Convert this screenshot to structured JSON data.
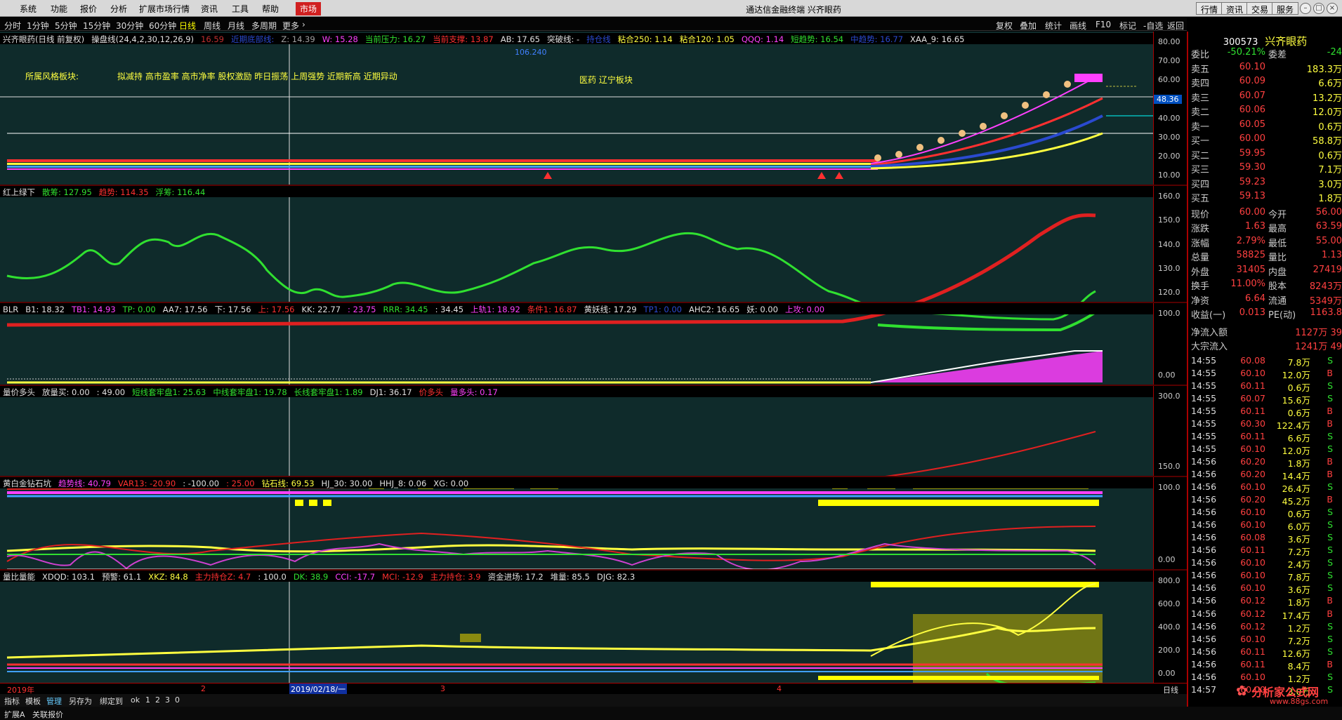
{
  "menu": {
    "items": [
      "系统",
      "功能",
      "报价",
      "分析",
      "扩展市场行情",
      "资讯",
      "工具",
      "帮助"
    ],
    "market": "市场"
  },
  "window": {
    "title": "通达信金融终端 兴齐眼药",
    "buttons": [
      "行情",
      "资讯",
      "交易",
      "服务"
    ]
  },
  "periods": {
    "items": [
      "分时",
      "1分钟",
      "5分钟",
      "15分钟",
      "30分钟",
      "60分钟",
      "日线",
      "周线",
      "月线",
      "多周期",
      "更多"
    ],
    "active": "日线"
  },
  "chart_tools": [
    "复权",
    "叠加",
    "统计",
    "画线",
    "F10",
    "标记",
    "-自选",
    "返回"
  ],
  "panes": [
    {
      "name": "main",
      "title_items": [
        {
          "t": "兴齐眼药(日线 前复权)",
          "c": "#e0e0e0"
        },
        {
          "t": "操盘线(24,4,2,30,12,26,9)",
          "c": "#e0e0e0"
        },
        {
          "t": "16.59",
          "c": "#c03030"
        },
        {
          "t": "近期底部线:",
          "c": "#2a4ad0"
        },
        {
          "t": "Z: 14.39",
          "c": "#a0a0a0"
        },
        {
          "t": "W: 15.28",
          "c": "#ff40ff"
        },
        {
          "t": "当前压力: 16.27",
          "c": "#30e030"
        },
        {
          "t": "当前支撑: 13.87",
          "c": "#ff3030"
        },
        {
          "t": "AB: 17.65",
          "c": "#e0e0e0"
        },
        {
          "t": "突破线: -",
          "c": "#e0e0e0"
        },
        {
          "t": "持仓线",
          "c": "#2a4ad0"
        },
        {
          "t": "粘合250: 1.14",
          "c": "#ffff40"
        },
        {
          "t": "粘合120: 1.05",
          "c": "#ffff40"
        },
        {
          "t": "QQQ: 1.14",
          "c": "#ff40ff"
        },
        {
          "t": "短趋势: 16.54",
          "c": "#30e030"
        },
        {
          "t": "中趋势: 16.77",
          "c": "#2a4ad0"
        },
        {
          "t": "XAA_9: 16.65",
          "c": "#e0e0e0"
        }
      ],
      "ticks": [
        "80.00",
        "70.00",
        "60.00",
        "50.00",
        "40.00",
        "30.00",
        "20.00",
        "10.00"
      ],
      "price_tag": "48.36",
      "peak_value": "106.240",
      "sector_label": "所属风格板块:",
      "style_tags": "拟减持 高市盈率 高市净率 股权激励 昨日振荡 上周强势 近期新高 近期异动",
      "industry": "医药 辽宁板块"
    },
    {
      "name": "hsl",
      "title_items": [
        {
          "t": "红上绿下",
          "c": "#e0e0e0"
        },
        {
          "t": "散筹: 127.95",
          "c": "#30e030"
        },
        {
          "t": "趋势: 114.35",
          "c": "#ff3030"
        },
        {
          "t": "浮筹: 116.44",
          "c": "#30e030"
        }
      ],
      "ticks": [
        "160.0",
        "150.0",
        "140.0",
        "130.0",
        "120.0"
      ]
    },
    {
      "name": "blr",
      "title_items": [
        {
          "t": "BLR",
          "c": "#e0e0e0"
        },
        {
          "t": "B1: 18.32",
          "c": "#e0e0e0"
        },
        {
          "t": "TB1: 14.93",
          "c": "#ff40ff"
        },
        {
          "t": "TP: 0.00",
          "c": "#30e030"
        },
        {
          "t": "AA7: 17.56",
          "c": "#e0e0e0"
        },
        {
          "t": "下: 17.56",
          "c": "#e0e0e0"
        },
        {
          "t": "上: 17.56",
          "c": "#ff3030"
        },
        {
          "t": "KK: 22.77",
          "c": "#e0e0e0"
        },
        {
          "t": ": 23.75",
          "c": "#ff40ff"
        },
        {
          "t": "RRR: 34.45",
          "c": "#30e030"
        },
        {
          "t": ": 34.45",
          "c": "#e0e0e0"
        },
        {
          "t": "上轨1: 18.92",
          "c": "#ff40ff"
        },
        {
          "t": "条件1: 16.87",
          "c": "#ff3030"
        },
        {
          "t": "黄妖线: 17.29",
          "c": "#e0e0e0"
        },
        {
          "t": "TP1: 0.00",
          "c": "#2a4ad0"
        },
        {
          "t": "AHC2: 16.65",
          "c": "#e0e0e0"
        },
        {
          "t": "妖: 0.00",
          "c": "#e0e0e0"
        },
        {
          "t": "上攻: 0.00",
          "c": "#ff40ff"
        }
      ],
      "ticks": [
        "100.0",
        "0.00"
      ]
    },
    {
      "name": "ljdt",
      "title_items": [
        {
          "t": "量价多头",
          "c": "#e0e0e0"
        },
        {
          "t": "放量买: 0.00",
          "c": "#e0e0e0"
        },
        {
          "t": ": 49.00",
          "c": "#e0e0e0"
        },
        {
          "t": "短线套牢盘1: 25.63",
          "c": "#30e030"
        },
        {
          "t": "中线套牢盘1: 19.78",
          "c": "#30e030"
        },
        {
          "t": "长线套牢盘1: 1.89",
          "c": "#30e030"
        },
        {
          "t": "DJ1: 36.17",
          "c": "#e0e0e0"
        },
        {
          "t": "价多头",
          "c": "#ff3030"
        },
        {
          "t": "量多头: 0.17",
          "c": "#ff40ff"
        }
      ],
      "ticks": [
        "300.0",
        "150.0"
      ]
    },
    {
      "name": "hbjzsk",
      "title_items": [
        {
          "t": "黄白金钻石坑",
          "c": "#e0e0e0"
        },
        {
          "t": "趋势线: 40.79",
          "c": "#ff40ff"
        },
        {
          "t": "VAR13: -20.90",
          "c": "#ff3030"
        },
        {
          "t": ": -100.00",
          "c": "#e0e0e0"
        },
        {
          "t": ": 25.00",
          "c": "#ff3030"
        },
        {
          "t": "钻石线: 69.53",
          "c": "#ffff40"
        },
        {
          "t": "HJ_30: 30.00",
          "c": "#e0e0e0"
        },
        {
          "t": "HHJ_8: 0.06",
          "c": "#e0e0e0"
        },
        {
          "t": "XG: 0.00",
          "c": "#e0e0e0"
        }
      ],
      "ticks": [
        "100.0",
        "0.00"
      ]
    },
    {
      "name": "lbln",
      "title_items": [
        {
          "t": "量比量能",
          "c": "#e0e0e0"
        },
        {
          "t": "XDQD: 103.1",
          "c": "#e0e0e0"
        },
        {
          "t": "预警: 61.1",
          "c": "#e0e0e0"
        },
        {
          "t": "XKZ: 84.8",
          "c": "#ffff40"
        },
        {
          "t": "主力持仓Z: 4.7",
          "c": "#ff3030"
        },
        {
          "t": ": 100.0",
          "c": "#e0e0e0"
        },
        {
          "t": "DK: 38.9",
          "c": "#30e030"
        },
        {
          "t": "CCI: -17.7",
          "c": "#ff40ff"
        },
        {
          "t": "MCI: -12.9",
          "c": "#ff3030"
        },
        {
          "t": "主力持仓: 3.9",
          "c": "#ff3030"
        },
        {
          "t": "资金进场: 17.2",
          "c": "#e0e0e0"
        },
        {
          "t": "堆量: 85.5",
          "c": "#e0e0e0"
        },
        {
          "t": "DJG: 82.3",
          "c": "#e0e0e0"
        }
      ],
      "ticks": [
        "800.0",
        "600.0",
        "400.0",
        "200.0",
        "0.00"
      ]
    }
  ],
  "date_axis": {
    "labels": [
      "2019年",
      "2",
      "2019/02/18/一",
      "3",
      "4"
    ],
    "period": "日线"
  },
  "bottom_tabs": [
    "指标",
    "模板",
    "管理",
    "另存为",
    "绑定到",
    "ok",
    "1",
    "2",
    "3",
    "0"
  ],
  "status": {
    "left": "扩展A",
    "right": "关联报价"
  },
  "quote": {
    "code": "300573",
    "name": "兴齐眼药",
    "weibi": {
      "label": "委比",
      "value": "-50.21%",
      "label2": "委差",
      "value2": "-24"
    },
    "asks": [
      {
        "label": "卖五",
        "price": "60.10",
        "vol": "183.3万"
      },
      {
        "label": "卖四",
        "price": "60.09",
        "vol": "6.6万"
      },
      {
        "label": "卖三",
        "price": "60.07",
        "vol": "13.2万"
      },
      {
        "label": "卖二",
        "price": "60.06",
        "vol": "12.0万"
      },
      {
        "label": "卖一",
        "price": "60.05",
        "vol": "0.6万"
      }
    ],
    "bids": [
      {
        "label": "买一",
        "price": "60.00",
        "vol": "58.8万"
      },
      {
        "label": "买二",
        "price": "59.95",
        "vol": "0.6万"
      },
      {
        "label": "买三",
        "price": "59.30",
        "vol": "7.1万"
      },
      {
        "label": "买四",
        "price": "59.23",
        "vol": "3.0万"
      },
      {
        "label": "买五",
        "price": "59.13",
        "vol": "1.8万"
      }
    ],
    "stats": [
      {
        "l1": "现价",
        "v1": "60.00",
        "l2": "今开",
        "v2": "56.00"
      },
      {
        "l1": "涨跌",
        "v1": "1.63",
        "l2": "最高",
        "v2": "63.59"
      },
      {
        "l1": "涨幅",
        "v1": "2.79%",
        "l2": "最低",
        "v2": "55.00"
      },
      {
        "l1": "总量",
        "v1": "58825",
        "l2": "量比",
        "v2": "1.13"
      },
      {
        "l1": "外盘",
        "v1": "31405",
        "l2": "内盘",
        "v2": "27419"
      },
      {
        "l1": "换手",
        "v1": "11.00%",
        "l2": "股本",
        "v2": "8243万"
      },
      {
        "l1": "净资",
        "v1": "6.64",
        "l2": "流通",
        "v2": "5349万"
      },
      {
        "l1": "收益(一)",
        "v1": "0.013",
        "l2": "PE(动)",
        "v2": "1163.8"
      }
    ],
    "flows": [
      {
        "label": "净流入额",
        "v": "1127万",
        "v2": "39"
      },
      {
        "label": "大宗流入",
        "v": "1241万",
        "v2": "49"
      }
    ],
    "ticks": [
      [
        "14:55",
        "60.08",
        "7.8万",
        "S"
      ],
      [
        "14:55",
        "60.10",
        "12.0万",
        "B"
      ],
      [
        "14:55",
        "60.11",
        "0.6万",
        "S"
      ],
      [
        "14:55",
        "60.07",
        "15.6万",
        "S"
      ],
      [
        "14:55",
        "60.11",
        "0.6万",
        "B"
      ],
      [
        "14:55",
        "60.30",
        "122.4万",
        "B"
      ],
      [
        "14:55",
        "60.11",
        "6.6万",
        "S"
      ],
      [
        "14:55",
        "60.10",
        "12.0万",
        "S"
      ],
      [
        "14:56",
        "60.20",
        "1.8万",
        "B"
      ],
      [
        "14:56",
        "60.20",
        "14.4万",
        "B"
      ],
      [
        "14:56",
        "60.10",
        "26.4万",
        "S"
      ],
      [
        "14:56",
        "60.20",
        "45.2万",
        "B"
      ],
      [
        "14:56",
        "60.10",
        "0.6万",
        "S"
      ],
      [
        "14:56",
        "60.10",
        "6.0万",
        "S"
      ],
      [
        "14:56",
        "60.08",
        "3.6万",
        "S"
      ],
      [
        "14:56",
        "60.11",
        "7.2万",
        "S"
      ],
      [
        "14:56",
        "60.10",
        "2.4万",
        "S"
      ],
      [
        "14:56",
        "60.10",
        "7.8万",
        "S"
      ],
      [
        "14:56",
        "60.10",
        "3.6万",
        "S"
      ],
      [
        "14:56",
        "60.12",
        "1.8万",
        "B"
      ],
      [
        "14:56",
        "60.12",
        "17.4万",
        "B"
      ],
      [
        "14:56",
        "60.12",
        "1.2万",
        "S"
      ],
      [
        "14:56",
        "60.10",
        "7.2万",
        "S"
      ],
      [
        "14:56",
        "60.11",
        "12.6万",
        "S"
      ],
      [
        "14:56",
        "60.11",
        "8.4万",
        "B"
      ],
      [
        "14:56",
        "60.10",
        "1.2万",
        "S"
      ],
      [
        "14:57",
        "60.00",
        "3.0万",
        "S"
      ]
    ]
  },
  "watermark": {
    "brand": "分析家公式网",
    "url": "www.88gs.com"
  }
}
